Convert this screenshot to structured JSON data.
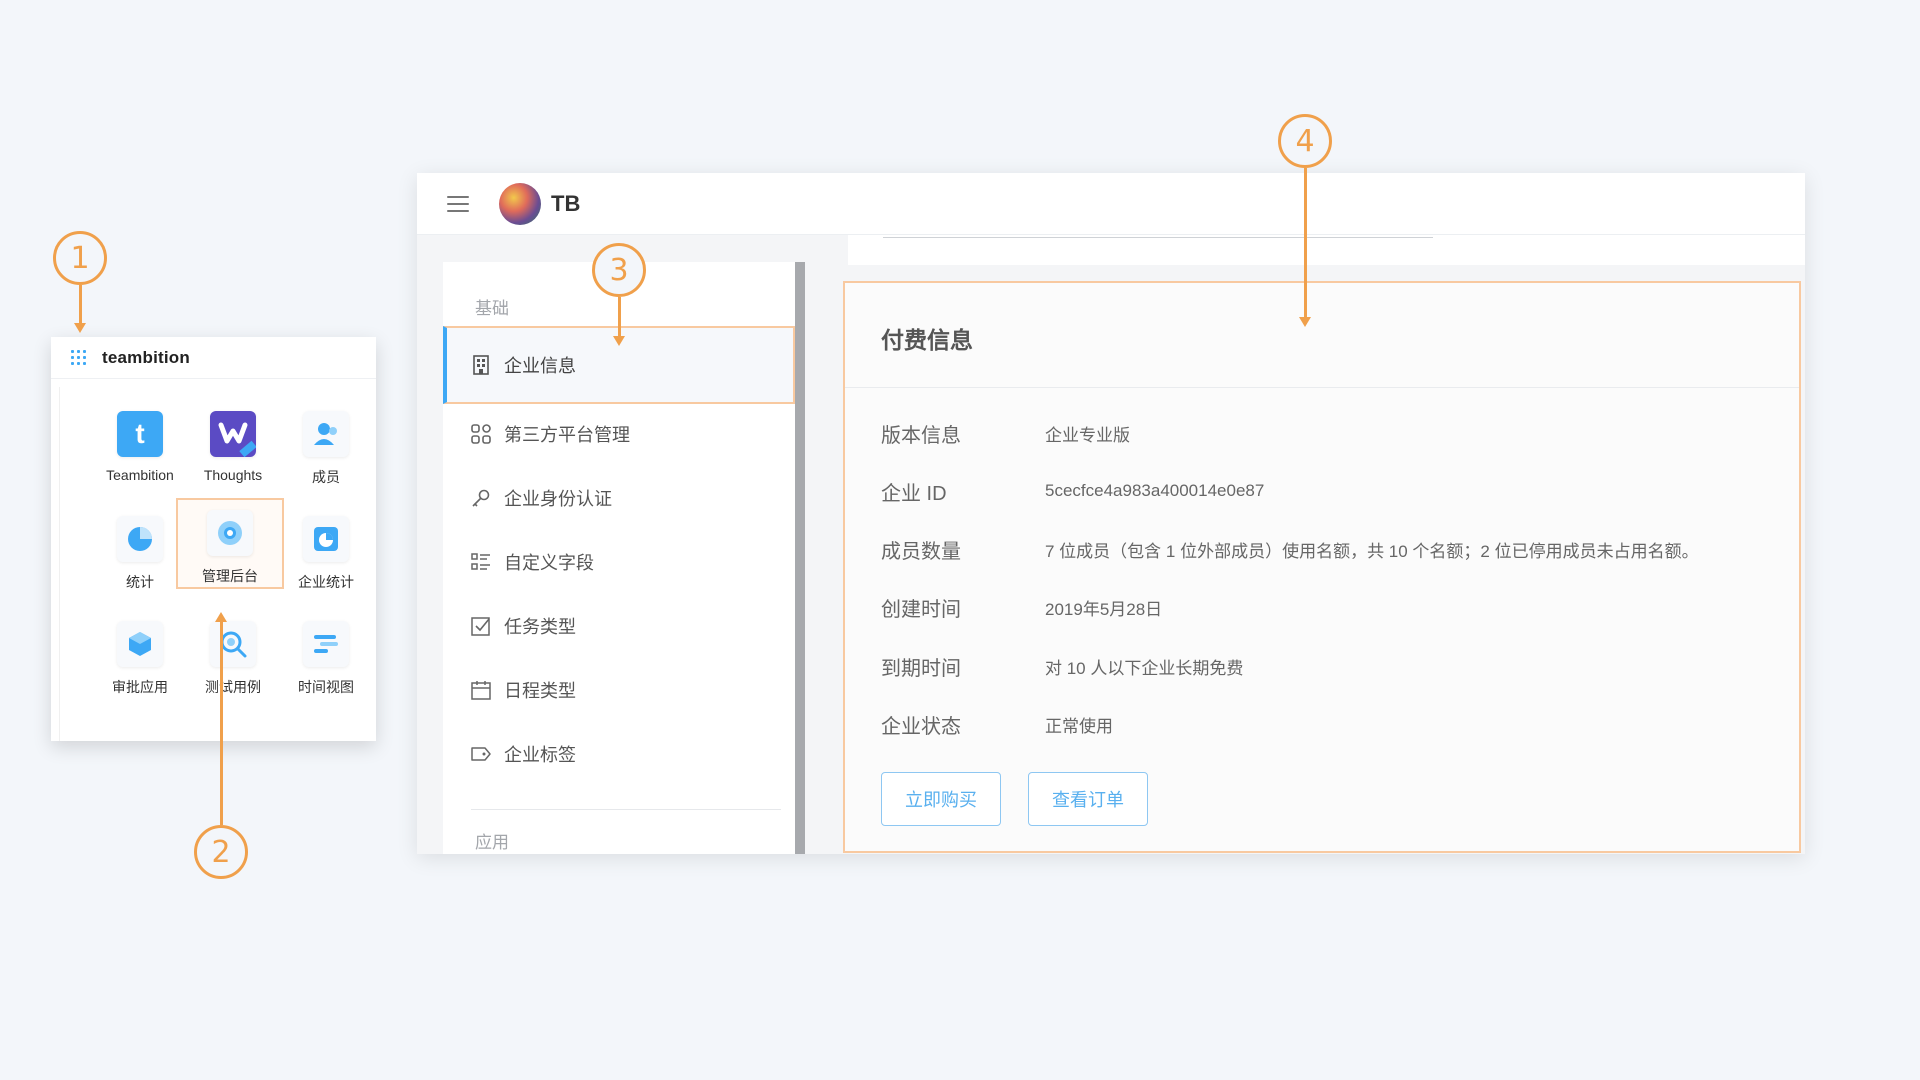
{
  "launcher": {
    "title": "teambition",
    "apps": [
      {
        "label": "Teambition",
        "icon": "teambition-t-icon"
      },
      {
        "label": "Thoughts",
        "icon": "thoughts-icon"
      },
      {
        "label": "成员",
        "icon": "members-icon"
      },
      {
        "label": "统计",
        "icon": "pie-chart-icon"
      },
      {
        "label": "管理后台",
        "icon": "admin-icon"
      },
      {
        "label": "企业统计",
        "icon": "enterprise-stats-icon"
      },
      {
        "label": "审批应用",
        "icon": "cube-icon"
      },
      {
        "label": "测试用例",
        "icon": "test-case-icon"
      },
      {
        "label": "时间视图",
        "icon": "timeline-icon"
      }
    ]
  },
  "topbar": {
    "org_name": "TB"
  },
  "sidebar": {
    "section_basic": "基础",
    "section_apps": "应用",
    "items": [
      {
        "label": "企业信息",
        "icon": "building-icon",
        "active": true
      },
      {
        "label": "第三方平台管理",
        "icon": "apps-grid-icon"
      },
      {
        "label": "企业身份认证",
        "icon": "key-icon"
      },
      {
        "label": "自定义字段",
        "icon": "fields-list-icon"
      },
      {
        "label": "任务类型",
        "icon": "task-check-icon"
      },
      {
        "label": "日程类型",
        "icon": "calendar-icon"
      },
      {
        "label": "企业标签",
        "icon": "tag-icon"
      }
    ]
  },
  "payment": {
    "title": "付费信息",
    "rows": [
      {
        "key": "版本信息",
        "value": "企业专业版"
      },
      {
        "key": "企业 ID",
        "value": "5cecfce4a983a400014e0e87"
      },
      {
        "key": "成员数量",
        "value": "7 位成员（包含 1 位外部成员）使用名额，共 10 个名额；2 位已停用成员未占用名额。"
      },
      {
        "key": "创建时间",
        "value": "2019年5月28日"
      },
      {
        "key": "到期时间",
        "value": "对 10 人以下企业长期免费"
      },
      {
        "key": "企业状态",
        "value": "正常使用"
      }
    ],
    "buy_button": "立即购买",
    "orders_button": "查看订单"
  },
  "callouts": [
    "1",
    "2",
    "3",
    "4"
  ],
  "colors": {
    "accent_blue": "#3da8f5",
    "callout_orange": "#f0a04b",
    "highlight_border": "#f8c9a0"
  }
}
